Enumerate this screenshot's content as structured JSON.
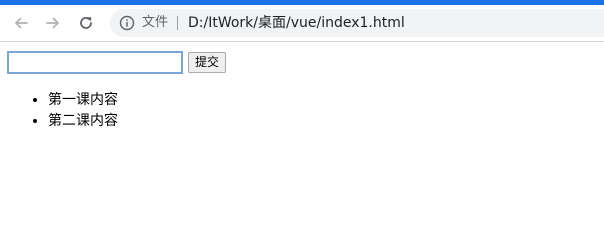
{
  "browser": {
    "address_label": "文件",
    "url": "D:/ItWork/桌面/vue/index1.html"
  },
  "form": {
    "input_value": "",
    "submit_label": "提交"
  },
  "list": {
    "items": [
      "第一课内容",
      "第二课内容"
    ]
  },
  "colors": {
    "accent": "#1a73e8",
    "omnibox_bg": "#f1f3f4"
  }
}
